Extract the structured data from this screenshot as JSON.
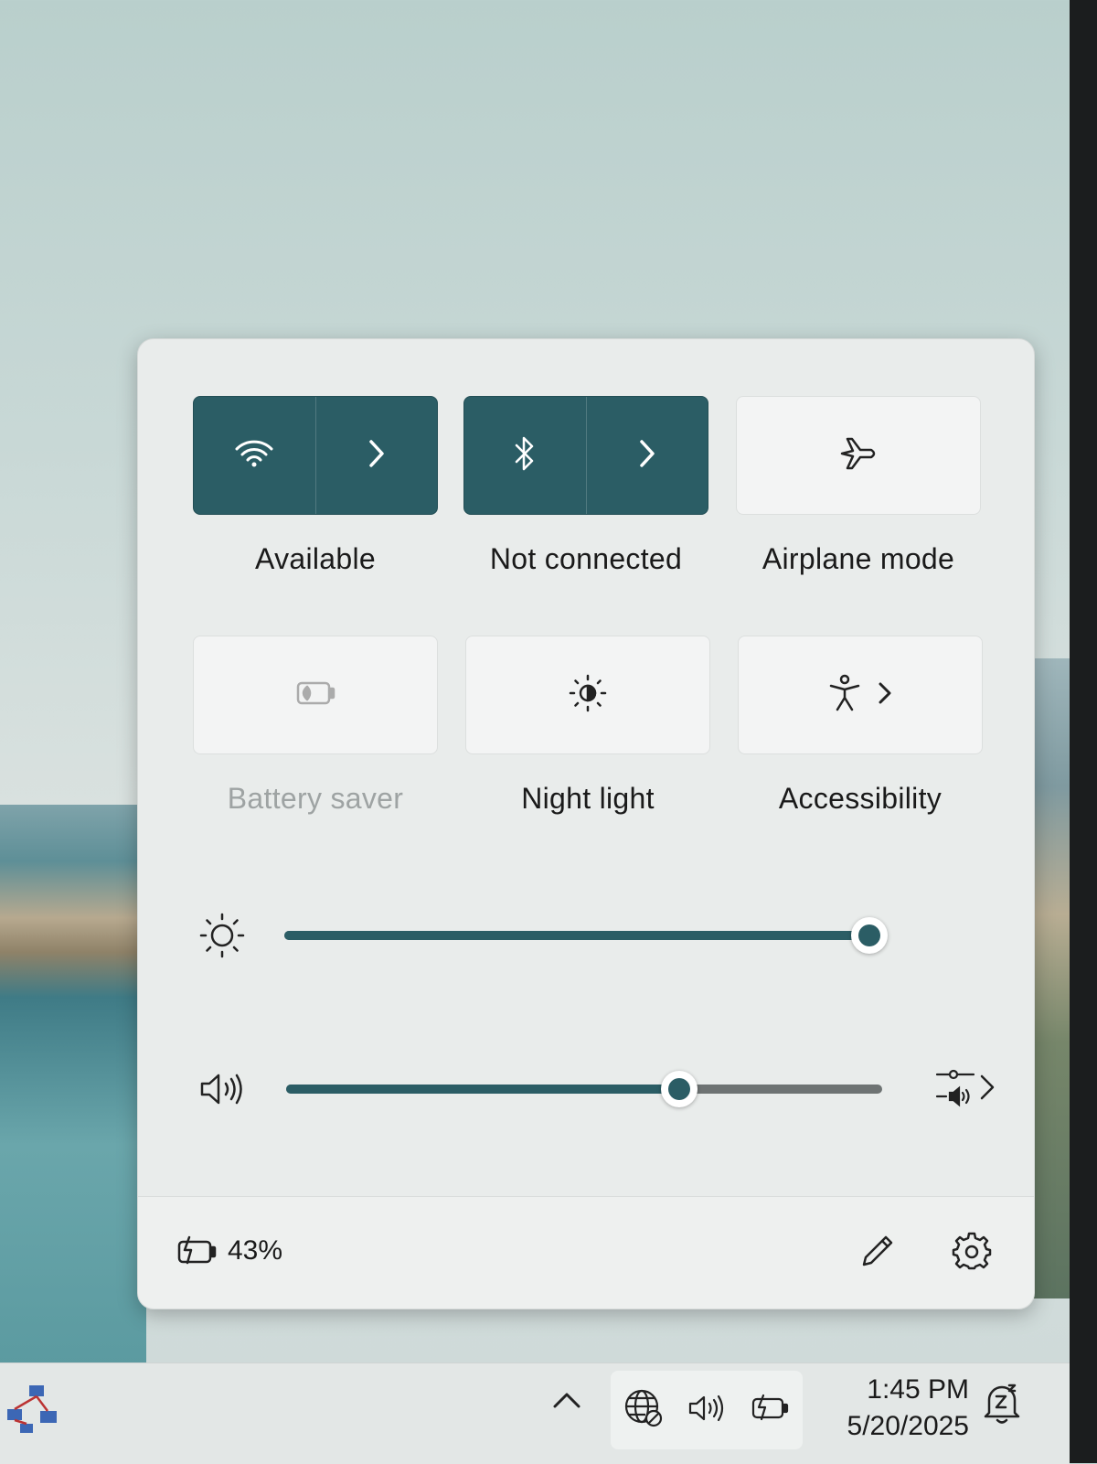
{
  "quick_settings": {
    "tiles": [
      {
        "label": "Available",
        "icon": "wifi-icon",
        "state": "on",
        "has_chevron": true
      },
      {
        "label": "Not connected",
        "icon": "bluetooth-icon",
        "state": "on",
        "has_chevron": true
      },
      {
        "label": "Airplane mode",
        "icon": "airplane-icon",
        "state": "off"
      },
      {
        "label": "Battery saver",
        "icon": "battery-saver-icon",
        "state": "disabled"
      },
      {
        "label": "Night light",
        "icon": "night-light-icon",
        "state": "off"
      },
      {
        "label": "Accessibility",
        "icon": "accessibility-icon",
        "state": "off",
        "has_chevron": true
      }
    ],
    "brightness": {
      "icon": "brightness-icon",
      "level": 1.0
    },
    "volume": {
      "icon": "speaker-icon",
      "level": 0.66
    },
    "footer": {
      "battery_percent": "43%",
      "battery_icon": "battery-charging-icon"
    },
    "accent_color": "#2b5d65"
  },
  "taskbar": {
    "time": "1:45 PM",
    "date": "5/20/2025",
    "tray_icons": [
      "chevron-up-icon",
      "network-icon",
      "speaker-icon",
      "battery-icon",
      "notifications-icon"
    ]
  }
}
